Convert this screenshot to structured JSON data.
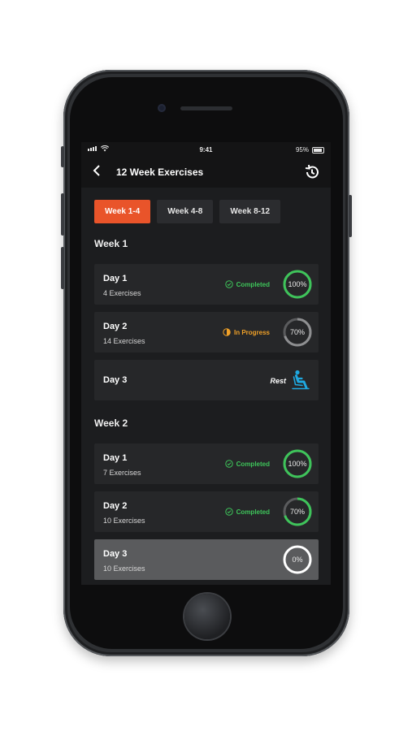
{
  "status_bar": {
    "time": "9:41",
    "battery": "95%",
    "battery_level": 0.95
  },
  "header": {
    "title": "12 Week Exercises",
    "back_icon": "chevron-left-icon",
    "history_icon": "history-icon"
  },
  "tabs": [
    {
      "label": "Week 1-4",
      "active": true
    },
    {
      "label": "Week 4-8",
      "active": false
    },
    {
      "label": "Week 8-12",
      "active": false
    }
  ],
  "weeks": [
    {
      "title": "Week 1",
      "days": [
        {
          "day": "Day 1",
          "exercises": "4 Exercises",
          "status": "Completed",
          "progress_label": "100%",
          "progress": 100
        },
        {
          "day": "Day 2",
          "exercises": "14 Exercises",
          "status": "In Progress",
          "progress_label": "70%",
          "progress": 70
        },
        {
          "day": "Day 3",
          "rest": "Rest",
          "rest_icon": "seated-rest-icon"
        }
      ]
    },
    {
      "title": "Week 2",
      "days": [
        {
          "day": "Day 1",
          "exercises": "7 Exercises",
          "status": "Completed",
          "progress_label": "100%",
          "progress": 100
        },
        {
          "day": "Day 2",
          "exercises": "10 Exercises",
          "status": "Completed",
          "progress_label": "70%",
          "progress": 70
        },
        {
          "day": "Day 3",
          "exercises": "10 Exercises",
          "progress_label": "0%",
          "progress": 0
        }
      ]
    }
  ],
  "colors": {
    "accent": "#e9542a",
    "completed": "#3ec45a",
    "in_progress": "#f0a128",
    "rest": "#1fa8e0"
  }
}
